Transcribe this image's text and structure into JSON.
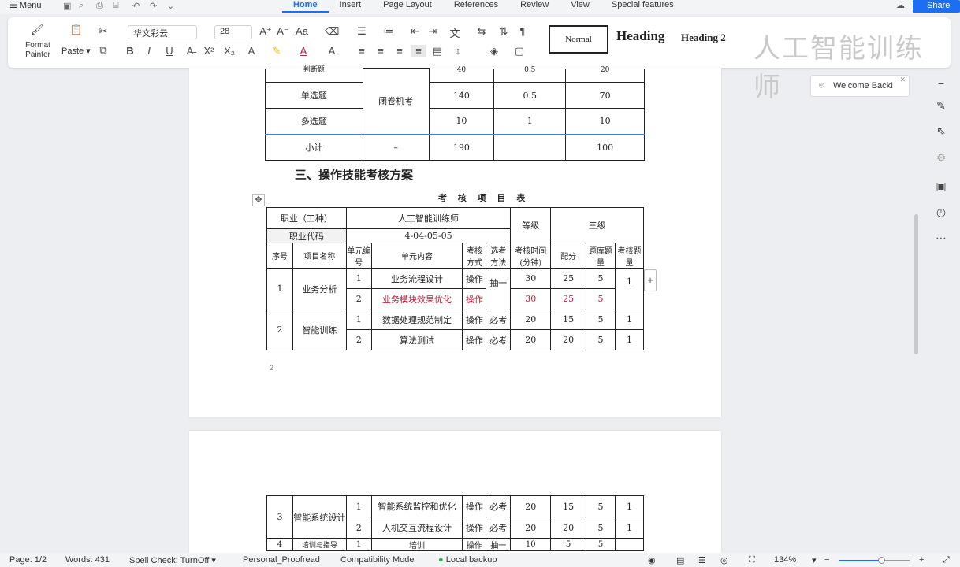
{
  "menubar": {
    "menu_label": "Menu",
    "share_label": "Share"
  },
  "tabs": [
    "Home",
    "Insert",
    "Page Layout",
    "References",
    "Review",
    "View",
    "Special features"
  ],
  "ribbon": {
    "format_painter": "Format Painter",
    "paste": "Paste",
    "font_name": "华文彩云",
    "font_size": "28",
    "styles": {
      "normal": "Normal",
      "heading1": "Heading",
      "heading2": "Heading 2"
    },
    "watermark": "人工智能训练师"
  },
  "exam_table": {
    "rows": [
      {
        "type": "判断题",
        "method": "",
        "count": "40",
        "score": "0.5",
        "total": "20"
      },
      {
        "type": "单选题",
        "method": "闭卷机考",
        "count": "140",
        "score": "0.5",
        "total": "70"
      },
      {
        "type": "多选题",
        "method": "",
        "count": "10",
        "score": "1",
        "total": "10"
      },
      {
        "type": "小计",
        "method": "–",
        "count": "190",
        "score": "",
        "total": "100"
      }
    ]
  },
  "section_title": "三、操作技能考核方案",
  "table_title": "考 核 项 目 表",
  "skill_table": {
    "profession_label": "职业（工种）",
    "profession_value": "人工智能训练师",
    "grade_label": "等级",
    "grade_value": "三级",
    "code_label": "职业代码",
    "code_value": "4-04-05-05",
    "headers": [
      "序号",
      "项目名称",
      "单元编号",
      "单元内容",
      "考核方式",
      "选考方法",
      "考核时间(分钟)",
      "配分",
      "题库题量",
      "考核题量"
    ],
    "groups": [
      {
        "no": "1",
        "name": "业务分析",
        "select": "抽一",
        "exam_count": "1",
        "units": [
          {
            "unit": "1",
            "content": "业务流程设计",
            "mode": "操作",
            "time": "30",
            "score": "25",
            "bank": "5",
            "red": false
          },
          {
            "unit": "2",
            "content": "业务模块效果优化",
            "mode": "操作",
            "time": "30",
            "score": "25",
            "bank": "5",
            "red": true
          }
        ]
      },
      {
        "no": "2",
        "name": "智能训练",
        "select": "",
        "exam_count": "",
        "units": [
          {
            "unit": "1",
            "content": "数据处理规范制定",
            "mode": "操作",
            "sel": "必考",
            "time": "20",
            "score": "15",
            "bank": "5",
            "cnt": "1",
            "red": false
          },
          {
            "unit": "2",
            "content": "算法测试",
            "mode": "操作",
            "sel": "必考",
            "time": "20",
            "score": "20",
            "bank": "5",
            "cnt": "1",
            "red": false
          }
        ]
      }
    ]
  },
  "page_number": "2",
  "page2_table": {
    "groups": [
      {
        "no": "3",
        "name": "智能系统设计",
        "units": [
          {
            "unit": "1",
            "content": "智能系统监控和优化",
            "mode": "操作",
            "sel": "必考",
            "time": "20",
            "score": "15",
            "bank": "5",
            "cnt": "1"
          },
          {
            "unit": "2",
            "content": "人机交互流程设计",
            "mode": "操作",
            "sel": "必考",
            "time": "20",
            "score": "20",
            "bank": "5",
            "cnt": "1"
          }
        ]
      },
      {
        "no": "4",
        "name": "培训与指导",
        "units": [
          {
            "unit": "1",
            "content": "培训",
            "mode": "操作",
            "sel": "抽一",
            "time": "10",
            "score": "5",
            "bank": "5",
            "cnt": ""
          }
        ]
      }
    ]
  },
  "welcome": "Welcome Back!",
  "status": {
    "page": "Page: 1/2",
    "words": "Words: 431",
    "spell": "Spell Check: TurnOff",
    "proofread": "Personal_Proofread",
    "compat": "Compatibility Mode",
    "backup": "Local backup",
    "zoom": "134%",
    "zoom_fraction": 0.6
  }
}
